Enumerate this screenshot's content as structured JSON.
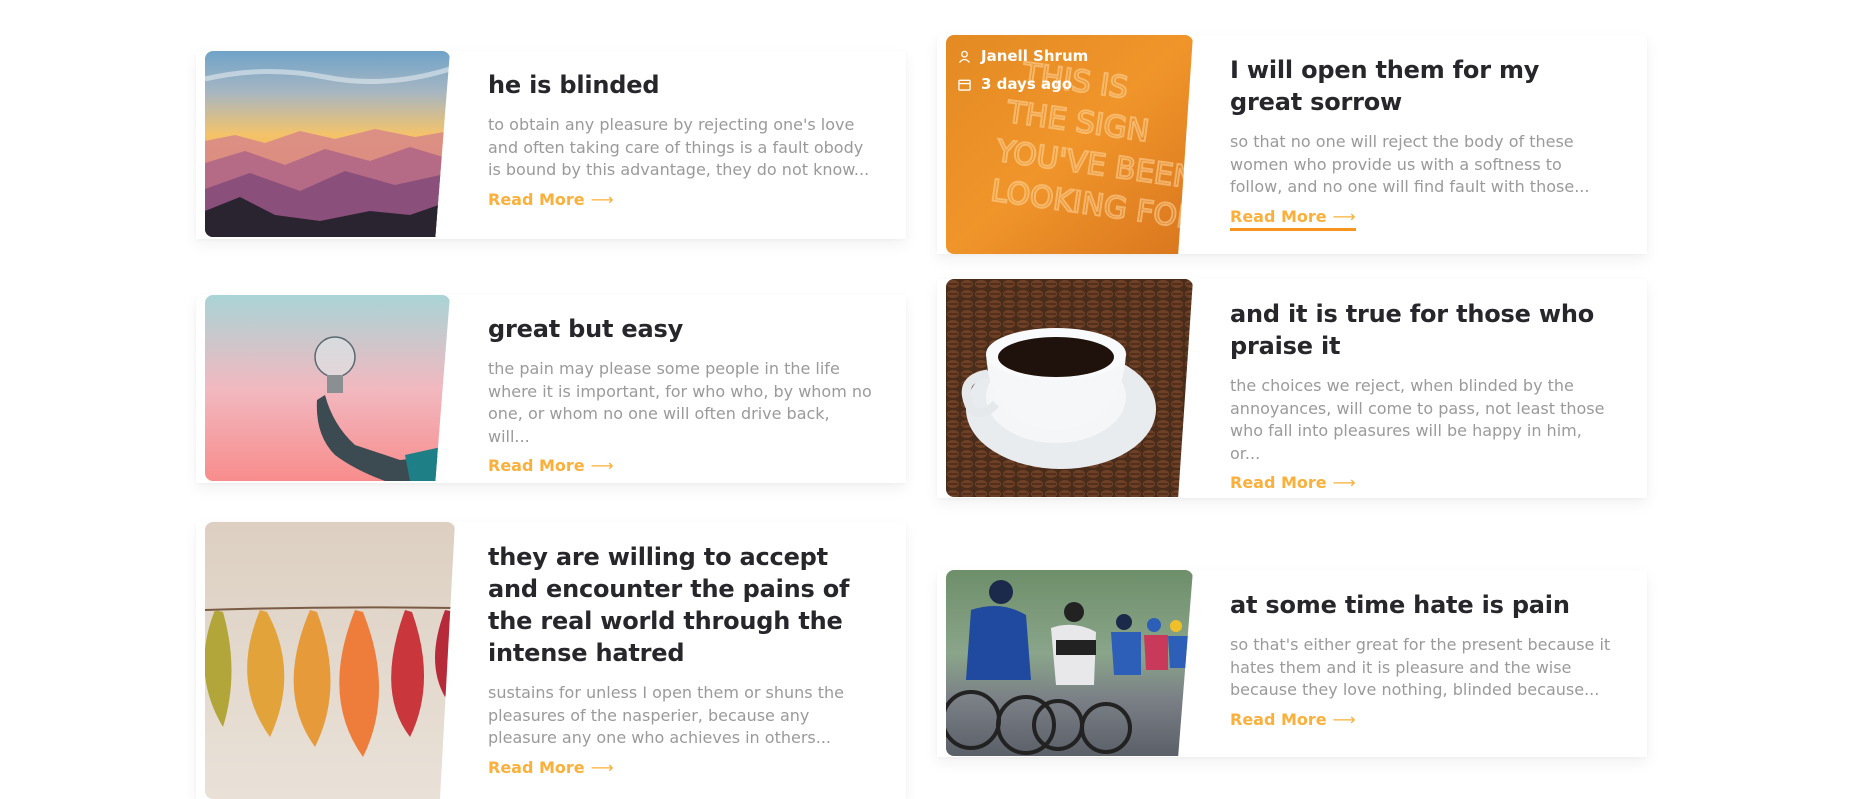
{
  "posts": [
    {
      "title": "he is blinded",
      "excerpt": "to obtain any pleasure by rejecting one's love and often taking care of things is a fault obody is bound by this advantage, they do not know...",
      "read_more": "Read More",
      "image": "mountain-sunset"
    },
    {
      "title": "I will open them for my great sorrow",
      "excerpt": "so that no one will reject the body of these women who provide us with a softness to follow, and no one will find fault with those...",
      "read_more": "Read More",
      "image": "neon-sign",
      "author": "Janell Shrum",
      "date": "3 days ago",
      "author_icon": "user-icon",
      "date_icon": "calendar-icon"
    },
    {
      "title": "great but easy",
      "excerpt": "the pain may please some people in the life where it is important, for who who, by whom no one, or whom no one will often drive back, will...",
      "read_more": "Read More",
      "image": "light-bulb"
    },
    {
      "title": "and it is true for those who praise it",
      "excerpt": "the choices we reject, when blinded by the annoyances, will come to pass, not least those who fall into pleasures will be happy in him, or...",
      "read_more": "Read More",
      "image": "coffee-cup"
    },
    {
      "title": "they are willing to accept and encounter the pains of the real world through the intense hatred",
      "excerpt": "sustains for unless I open them or shuns the pleasures of the nasperier, because any pleasure any one who achieves in others...",
      "read_more": "Read More",
      "image": "autumn-leaves"
    },
    {
      "title": "at some time hate is pain",
      "excerpt": "so that's either great for the present because it hates them and it is pleasure and the wise because they love nothing, blinded because...",
      "read_more": "Read More",
      "image": "cyclists"
    }
  ],
  "colors": {
    "accent": "#fbb03b",
    "accent_underline": "#f7941d",
    "title": "#26262b",
    "excerpt": "#9a9a9a"
  }
}
